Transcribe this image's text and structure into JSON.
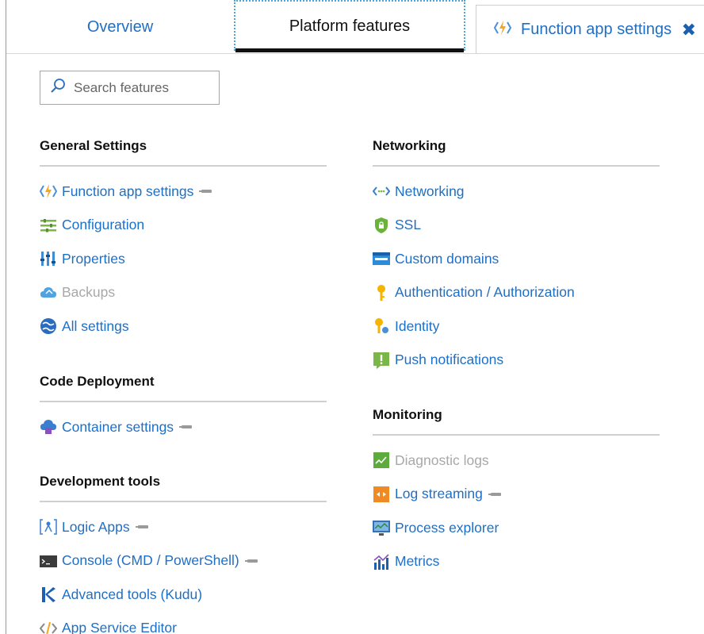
{
  "tabs": {
    "overview": "Overview",
    "platform_features": "Platform features",
    "function_app_settings": "Function app settings",
    "close_glyph": "✖"
  },
  "search": {
    "placeholder": "Search features"
  },
  "sections": {
    "general": {
      "title": "General Settings",
      "items": [
        {
          "label": "Function app settings",
          "icon": "function-lightning-icon",
          "pinned": true,
          "enabled": true
        },
        {
          "label": "Configuration",
          "icon": "configuration-sliders-icon",
          "pinned": false,
          "enabled": true
        },
        {
          "label": "Properties",
          "icon": "properties-bars-icon",
          "pinned": false,
          "enabled": true
        },
        {
          "label": "Backups",
          "icon": "backups-cloud-icon",
          "pinned": false,
          "enabled": false
        },
        {
          "label": "All settings",
          "icon": "all-settings-globe-icon",
          "pinned": false,
          "enabled": true
        }
      ]
    },
    "code_deployment": {
      "title": "Code Deployment",
      "items": [
        {
          "label": "Container settings",
          "icon": "container-cloud-icon",
          "pinned": true,
          "enabled": true
        }
      ]
    },
    "dev_tools": {
      "title": "Development tools",
      "items": [
        {
          "label": "Logic Apps",
          "icon": "logic-apps-icon",
          "pinned": true,
          "enabled": true
        },
        {
          "label": "Console (CMD / PowerShell)",
          "icon": "console-icon",
          "pinned": true,
          "enabled": true
        },
        {
          "label": "Advanced tools (Kudu)",
          "icon": "kudu-icon",
          "pinned": false,
          "enabled": true
        },
        {
          "label": "App Service Editor",
          "icon": "code-editor-icon",
          "pinned": false,
          "enabled": true
        }
      ]
    },
    "networking": {
      "title": "Networking",
      "items": [
        {
          "label": "Networking",
          "icon": "networking-arrows-icon",
          "pinned": false,
          "enabled": true
        },
        {
          "label": "SSL",
          "icon": "ssl-shield-icon",
          "pinned": false,
          "enabled": true
        },
        {
          "label": "Custom domains",
          "icon": "custom-domains-icon",
          "pinned": false,
          "enabled": true
        },
        {
          "label": "Authentication / Authorization",
          "icon": "key-icon",
          "pinned": false,
          "enabled": true
        },
        {
          "label": "Identity",
          "icon": "identity-key-icon",
          "pinned": false,
          "enabled": true
        },
        {
          "label": "Push notifications",
          "icon": "push-notification-icon",
          "pinned": false,
          "enabled": true
        }
      ]
    },
    "monitoring": {
      "title": "Monitoring",
      "items": [
        {
          "label": "Diagnostic logs",
          "icon": "diagnostic-logs-icon",
          "pinned": false,
          "enabled": false
        },
        {
          "label": "Log streaming",
          "icon": "log-streaming-icon",
          "pinned": true,
          "enabled": true
        },
        {
          "label": "Process explorer",
          "icon": "process-explorer-icon",
          "pinned": false,
          "enabled": true
        },
        {
          "label": "Metrics",
          "icon": "metrics-chart-icon",
          "pinned": false,
          "enabled": true
        }
      ]
    }
  },
  "colors": {
    "link": "#1f6fc5",
    "disabled": "#a8a8a8",
    "active_underline": "#111111",
    "tab_focus_border": "#48a9d8"
  }
}
